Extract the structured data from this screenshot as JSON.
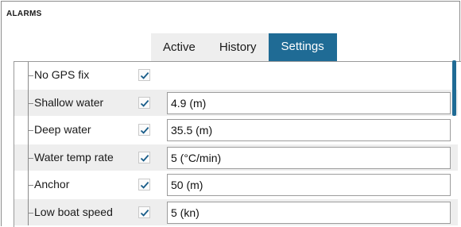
{
  "window": {
    "title": "ALARMS"
  },
  "tabs": [
    {
      "label": "Active",
      "selected": false
    },
    {
      "label": "History",
      "selected": false
    },
    {
      "label": "Settings",
      "selected": true
    }
  ],
  "alarms": [
    {
      "label": "No GPS fix",
      "enabled": true,
      "value": null
    },
    {
      "label": "Shallow water",
      "enabled": true,
      "value": "4.9 (m)"
    },
    {
      "label": "Deep water",
      "enabled": true,
      "value": "35.5 (m)"
    },
    {
      "label": "Water temp rate",
      "enabled": true,
      "value": "5 (°C/min)"
    },
    {
      "label": "Anchor",
      "enabled": true,
      "value": "50 (m)"
    },
    {
      "label": "Low boat speed",
      "enabled": true,
      "value": "5 (kn)"
    }
  ],
  "colors": {
    "accent": "#1f6b95",
    "checkmark": "#1a5e8a",
    "row_shade": "#eeeeee"
  },
  "icons": {
    "checkbox": "checkmark-icon"
  }
}
